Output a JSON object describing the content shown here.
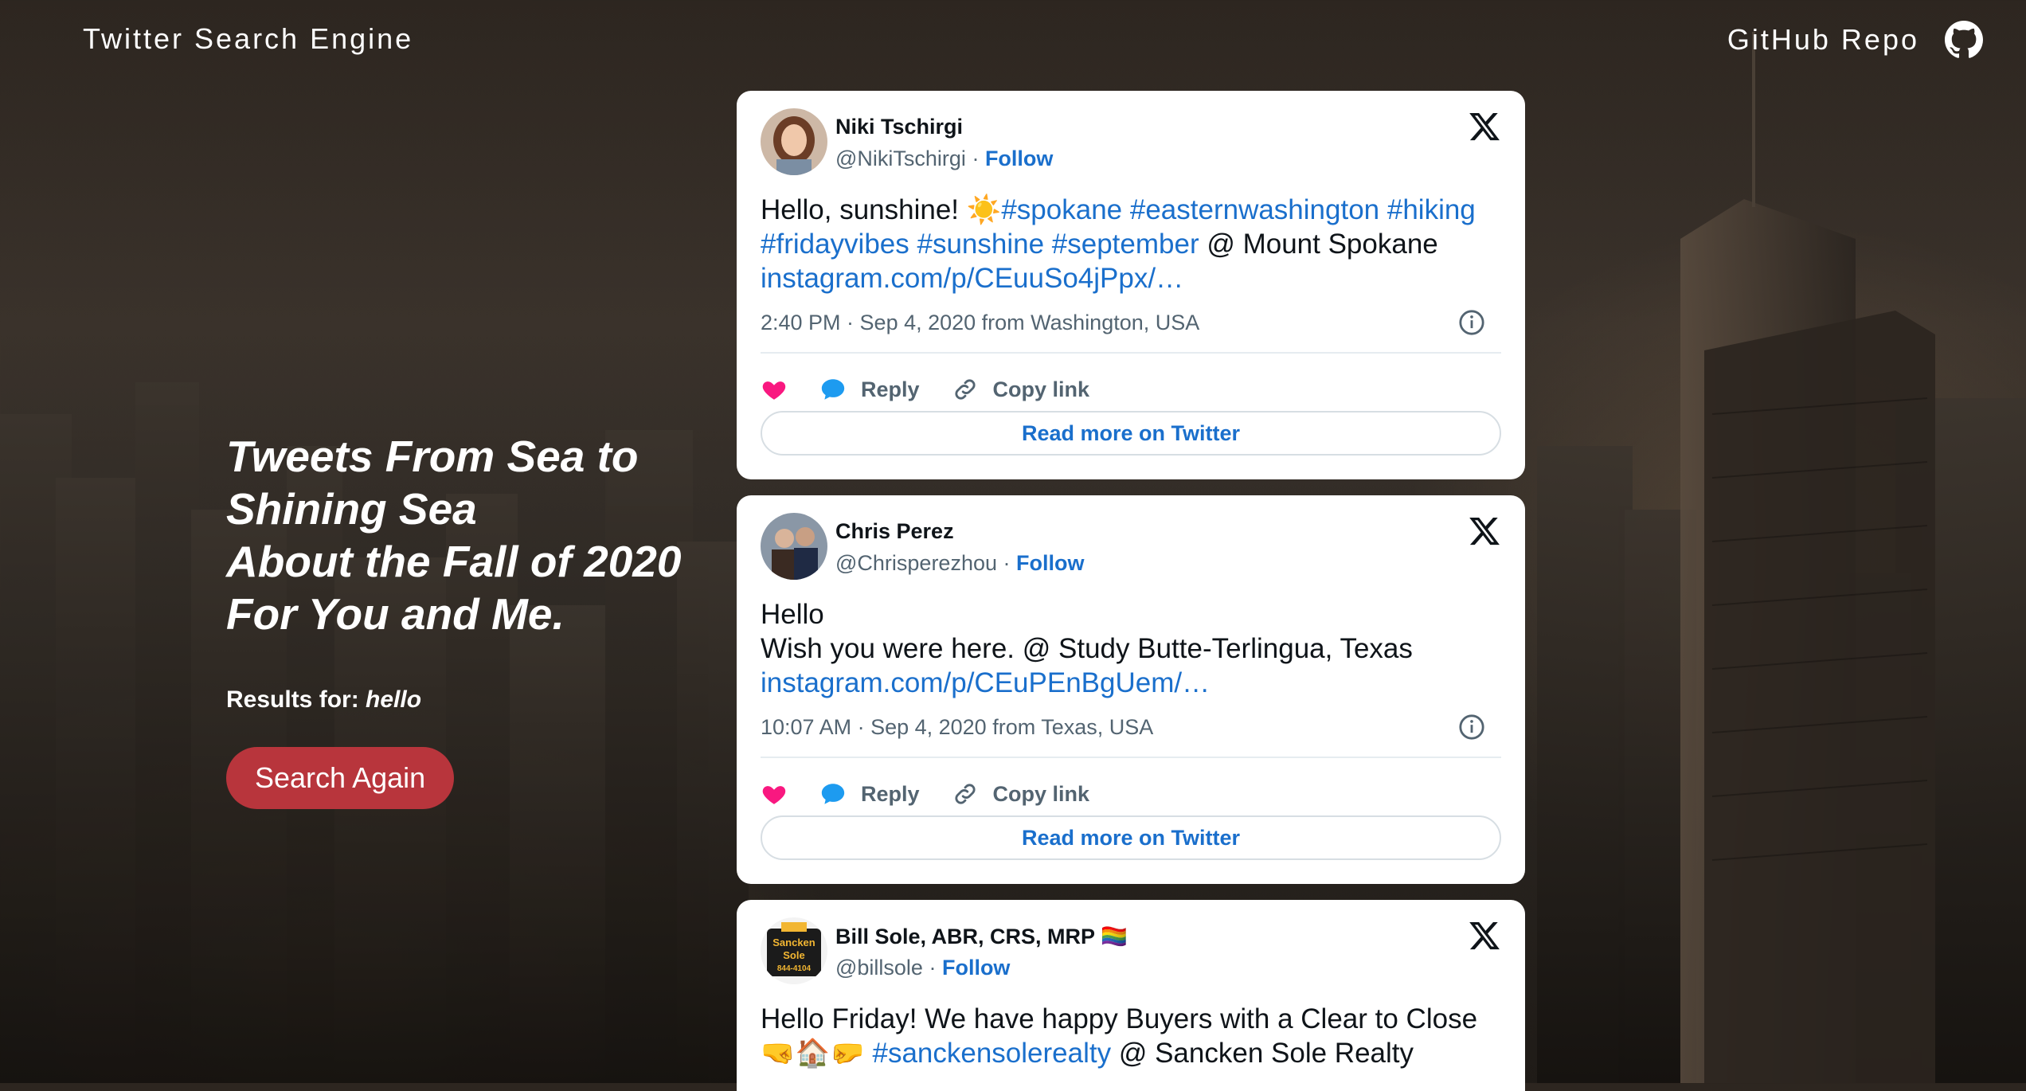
{
  "header": {
    "brand": "Twitter Search Engine",
    "repo_label": "GitHub Repo",
    "repo_icon": "github-icon"
  },
  "hero": {
    "title_lines": [
      "Tweets From Sea to",
      "Shining Sea",
      "About the Fall of 2020",
      "For You and Me."
    ],
    "results_label": "Results for:",
    "query": "hello",
    "search_again": "Search Again"
  },
  "colors": {
    "accent_button": "#b8353c",
    "link": "#1a6fcc",
    "like": "#f91880",
    "reply": "#1d9bf0"
  },
  "tweets": [
    {
      "name": "Niki Tschirgi",
      "handle": "@NikiTschirgi",
      "follow": "Follow",
      "line1_text": "Hello, sunshine! ☀️",
      "line1_tags": "#spokane #easternwashington #hiking",
      "line2_tags": "#fridayvibes #sunshine #september",
      "line2_text": " @ Mount Spokane",
      "line3_link": "instagram.com/p/CEuuSo4jPpx/…",
      "meta": "2:40 PM · Sep 4, 2020 from Washington, USA",
      "reply": "Reply",
      "copy": "Copy link",
      "read_more": "Read more on Twitter"
    },
    {
      "name": "Chris Perez",
      "handle": "@Chrisperezhou",
      "follow": "Follow",
      "line1_text": "Hello",
      "line2_text": "Wish you were here. @ Study Butte-Terlingua, Texas",
      "line3_link": "instagram.com/p/CEuPEnBgUem/…",
      "meta": "10:07 AM · Sep 4, 2020 from Texas, USA",
      "reply": "Reply",
      "copy": "Copy link",
      "read_more": "Read more on Twitter"
    },
    {
      "name": "Bill Sole, ABR, CRS, MRP",
      "name_emoji": "🏳️‍🌈",
      "handle": "@billsole",
      "follow": "Follow",
      "line1_text": "Hello Friday! We have happy Buyers with a Clear to Close",
      "line2_emoji": "🤜🏠🤛",
      "line2_tag": "#sanckensolerealty",
      "line2_text": " @ Sancken Sole Realty",
      "avatar_logo_lines": [
        "Sancken",
        "Sole",
        "844-4104"
      ]
    }
  ]
}
